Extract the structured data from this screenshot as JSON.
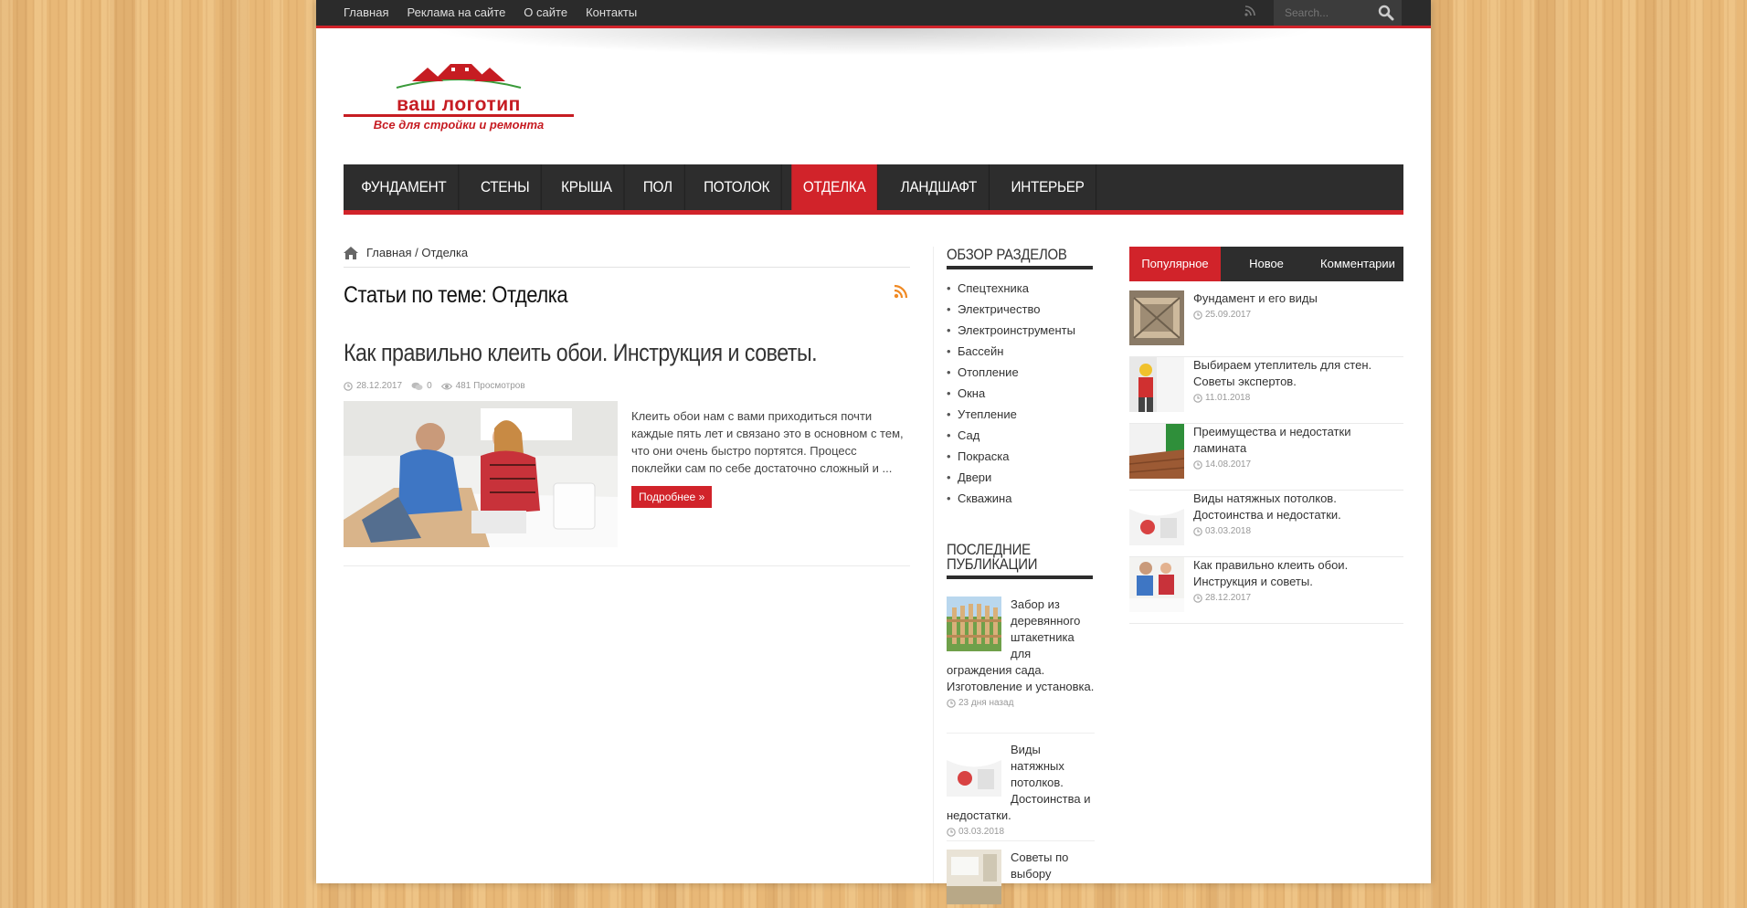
{
  "topbar": {
    "links": [
      "Главная",
      "Реклама на сайте",
      "О сайте",
      "Контакты"
    ],
    "search_placeholder": "Search..."
  },
  "logo": {
    "title": "ваш логотип",
    "subtitle": "Все для стройки и ремонта"
  },
  "mainnav": {
    "items": [
      "ФУНДАМЕНТ",
      "СТЕНЫ",
      "КРЫША",
      "ПОЛ",
      "ПОТОЛОК",
      "ОТДЕЛКА",
      "ЛАНДШАФТ",
      "ИНТЕРЬЕР"
    ],
    "active": "ОТДЕЛКА"
  },
  "breadcrumb": {
    "home": "Главная",
    "separator": "/",
    "current": "Отделка"
  },
  "section": {
    "title": "Статьи по теме: Отделка"
  },
  "article": {
    "title": "Как правильно клеить обои. Инструкция и советы.",
    "date": "28.12.2017",
    "comments": "0",
    "views": "481 Просмотров",
    "excerpt": "Клеить обои нам с вами приходиться почти каждые пять лет и связано это в основном с тем, что они очень быстро портятся. Процесс поклейки сам по себе достаточно сложный и ...",
    "more_label": "Подробнее »"
  },
  "categories": {
    "title": "ОБЗОР РАЗДЕЛОВ",
    "items": [
      "Спецтехника",
      "Электричество",
      "Электроинструменты",
      "Бассейн",
      "Отопление",
      "Окна",
      "Утепление",
      "Сад",
      "Покраска",
      "Двери",
      "Скважина"
    ]
  },
  "recent": {
    "title": "ПОСЛЕДНИЕ ПУБЛИКАЦИИ",
    "items": [
      {
        "title": "Забор из деревянного штакетника для ограждения сада. Изготовление и установка.",
        "date": "23 дня назад"
      },
      {
        "title": "Виды натяжных потолков. Достоинства и недостатки.",
        "date": "03.03.2018"
      },
      {
        "title": "Советы по выбору",
        "date": ""
      }
    ]
  },
  "tabs": {
    "popular": "Популярное",
    "new": "Новое",
    "comments": "Комментарии"
  },
  "popular": [
    {
      "title": "Фундамент и его виды",
      "date": "25.09.2017"
    },
    {
      "title": "Выбираем утеплитель для стен. Советы экспертов.",
      "date": "11.01.2018"
    },
    {
      "title": "Преимущества и недостатки ламината",
      "date": "14.08.2017"
    },
    {
      "title": "Виды натяжных потолков. Достоинства и недостатки.",
      "date": "03.03.2018"
    },
    {
      "title": "Как правильно клеить обои. Инструкция и советы.",
      "date": "28.12.2017"
    }
  ],
  "colors": {
    "accent": "#d1232a",
    "dark": "#2d2d2d",
    "rss": "#f08a24"
  }
}
